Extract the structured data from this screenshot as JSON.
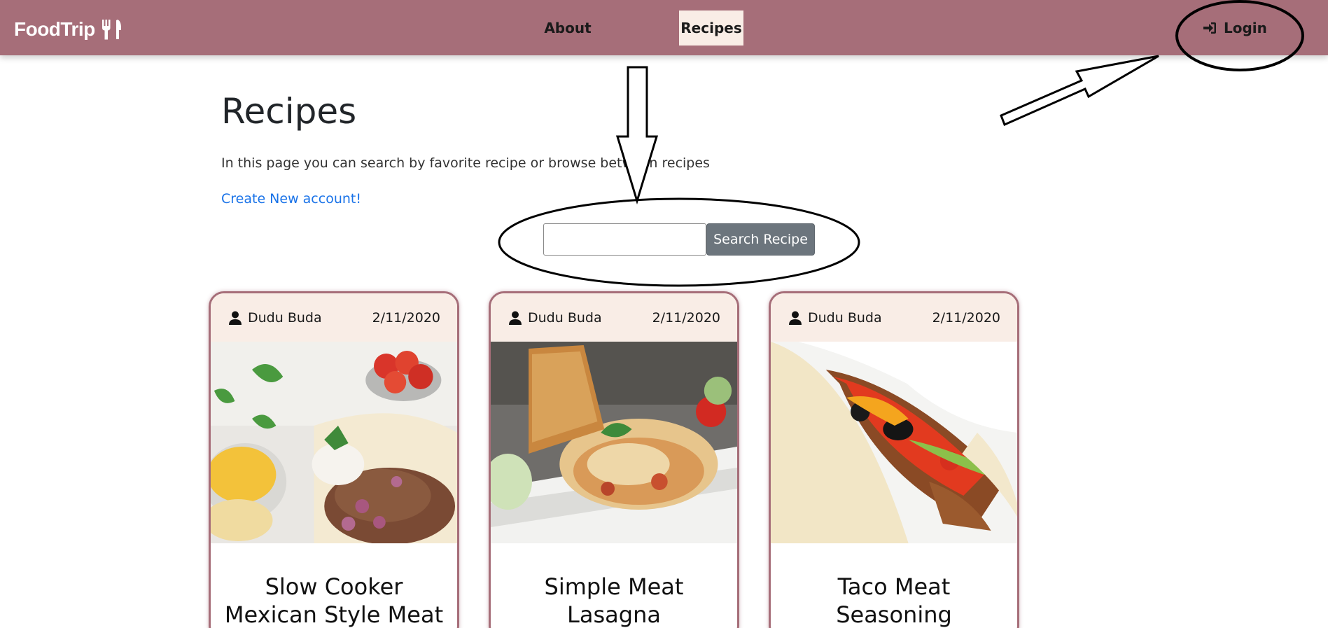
{
  "nav": {
    "brand": "FoodTrip",
    "brand_icon": "utensils-icon",
    "links": [
      "About",
      "Recipes"
    ],
    "active": "Recipes",
    "login_label": "Login",
    "login_icon": "sign-in-icon"
  },
  "page": {
    "title": "Recipes",
    "description": "In this page you can search by favorite recipe or browse between recipes",
    "create_account_link": "Create New account!"
  },
  "search": {
    "value": "",
    "placeholder": "",
    "button_label": "Search Recipe"
  },
  "recipes": [
    {
      "author": "Dudu Buda",
      "date": "2/11/2020",
      "title": "Slow Cooker Mexican Style Meat",
      "image": "tacos-with-meat-and-salsa"
    },
    {
      "author": "Dudu Buda",
      "date": "2/11/2020",
      "title": "Simple Meat Lasagna",
      "image": "lasagna-with-garlic-bread"
    },
    {
      "author": "Dudu Buda",
      "date": "2/11/2020",
      "title": "Taco Meat Seasoning",
      "image": "taco-with-ground-meat"
    }
  ],
  "colors": {
    "navbar": "#a66e79",
    "card_header": "#f9ede6",
    "link": "#1a73e8",
    "button": "#6c757d"
  }
}
